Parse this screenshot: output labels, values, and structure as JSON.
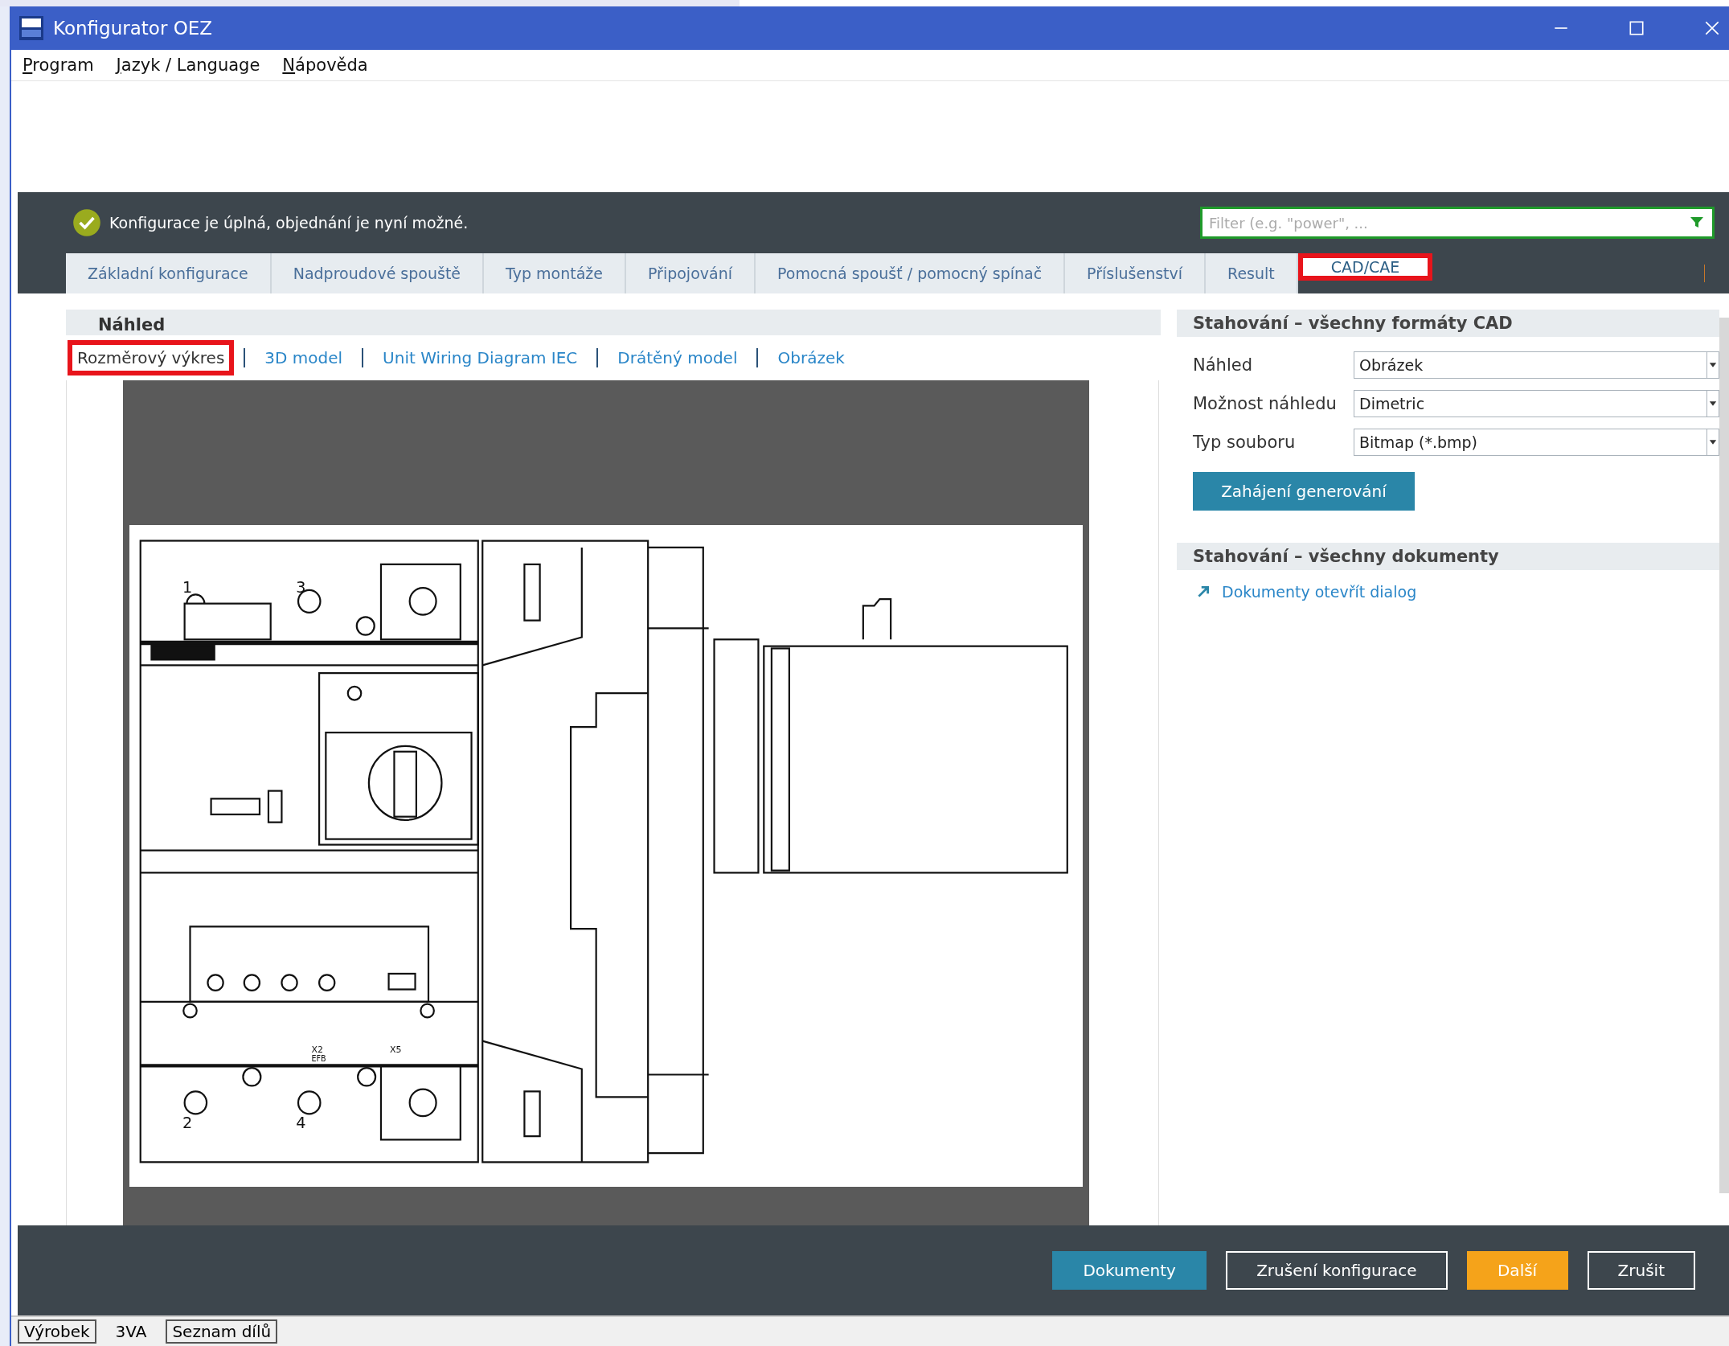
{
  "window": {
    "title": "Konfigurator OEZ"
  },
  "menu": [
    "Program",
    "Jazyk / Language",
    "Nápověda"
  ],
  "status": {
    "complete": true,
    "message": "Konfigurace je úplná, objednání je nyní možné."
  },
  "filter": {
    "placeholder": "Filter (e.g. \"power\", ..."
  },
  "tabs": [
    {
      "label": "Základní konfigurace",
      "selected": false,
      "highlighted": false
    },
    {
      "label": "Nadproudové spouště",
      "selected": false,
      "highlighted": false
    },
    {
      "label": "Typ montáže",
      "selected": false,
      "highlighted": false
    },
    {
      "label": "Připojování",
      "selected": false,
      "highlighted": false
    },
    {
      "label": "Pomocná spoušť / pomocný spínač",
      "selected": false,
      "highlighted": false
    },
    {
      "label": "Příslušenství",
      "selected": false,
      "highlighted": false
    },
    {
      "label": "Result",
      "selected": false,
      "highlighted": false
    },
    {
      "label": "CAD/CAE",
      "selected": true,
      "highlighted": true
    }
  ],
  "preview": {
    "title": "Náhled",
    "views": [
      {
        "label": "Rozměrový výkres",
        "selected": true,
        "highlighted": true
      },
      {
        "label": "3D model",
        "selected": false,
        "highlighted": false
      },
      {
        "label": "Unit Wiring Diagram IEC",
        "selected": false,
        "highlighted": false
      },
      {
        "label": "Drátěný model",
        "selected": false,
        "highlighted": false
      },
      {
        "label": "Obrázek",
        "selected": false,
        "highlighted": false
      }
    ],
    "drawing_labels": [
      "1",
      "3",
      "2",
      "4",
      "X2",
      "EFB",
      "X5"
    ]
  },
  "download_cad": {
    "title": "Stahování – všechny formáty CAD",
    "fields": [
      {
        "label": "Náhled",
        "value": "Obrázek"
      },
      {
        "label": "Možnost náhledu",
        "value": "Dimetric"
      },
      {
        "label": "Typ souboru",
        "value": "Bitmap (*.bmp)"
      }
    ],
    "button": "Zahájení generování"
  },
  "download_docs": {
    "title": "Stahování – všechny dokumenty",
    "link": "Dokumenty otevřít dialog"
  },
  "footer_buttons": [
    {
      "label": "Dokumenty",
      "kind": "secondary"
    },
    {
      "label": "Zrušení konfigurace",
      "kind": "outline"
    },
    {
      "label": "Další",
      "kind": "primary"
    },
    {
      "label": "Zrušit",
      "kind": "outline"
    }
  ],
  "status_bar": [
    {
      "label": "Výrobek",
      "kind": "tab"
    },
    {
      "label": "3VA",
      "kind": "text"
    },
    {
      "label": "Seznam dílů",
      "kind": "tab"
    }
  ]
}
